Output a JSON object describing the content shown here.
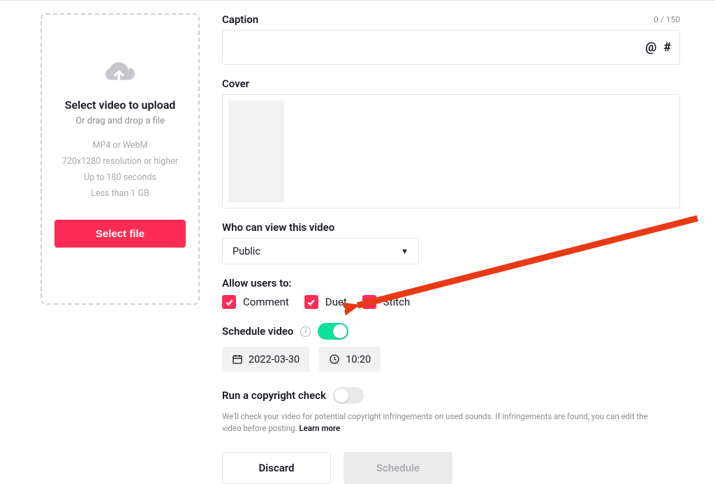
{
  "upload": {
    "title": "Select video to upload",
    "subtitle": "Or drag and drop a file",
    "hints": [
      "MP4 or WebM",
      "720x1280 resolution or higher",
      "Up to 180 seconds",
      "Less than 1 GB"
    ],
    "button": "Select file"
  },
  "caption": {
    "label": "Caption",
    "counter": "0 / 150",
    "mention_symbol": "@",
    "hashtag_symbol": "#"
  },
  "cover": {
    "label": "Cover"
  },
  "privacy": {
    "label": "Who can view this video",
    "value": "Public"
  },
  "allow": {
    "label": "Allow users to:",
    "options": [
      {
        "label": "Comment",
        "checked": true
      },
      {
        "label": "Duet",
        "checked": true
      },
      {
        "label": "Stitch",
        "checked": true
      }
    ]
  },
  "schedule": {
    "label": "Schedule video",
    "enabled": true,
    "date": "2022-03-30",
    "time": "10:20"
  },
  "copyright": {
    "label": "Run a copyright check",
    "enabled": false,
    "description_a": "We'll check your video for potential copyright infringements on used sounds. If infringements are found, you can edit the video before posting. ",
    "learn_more": "Learn more"
  },
  "actions": {
    "discard": "Discard",
    "schedule": "Schedule"
  }
}
